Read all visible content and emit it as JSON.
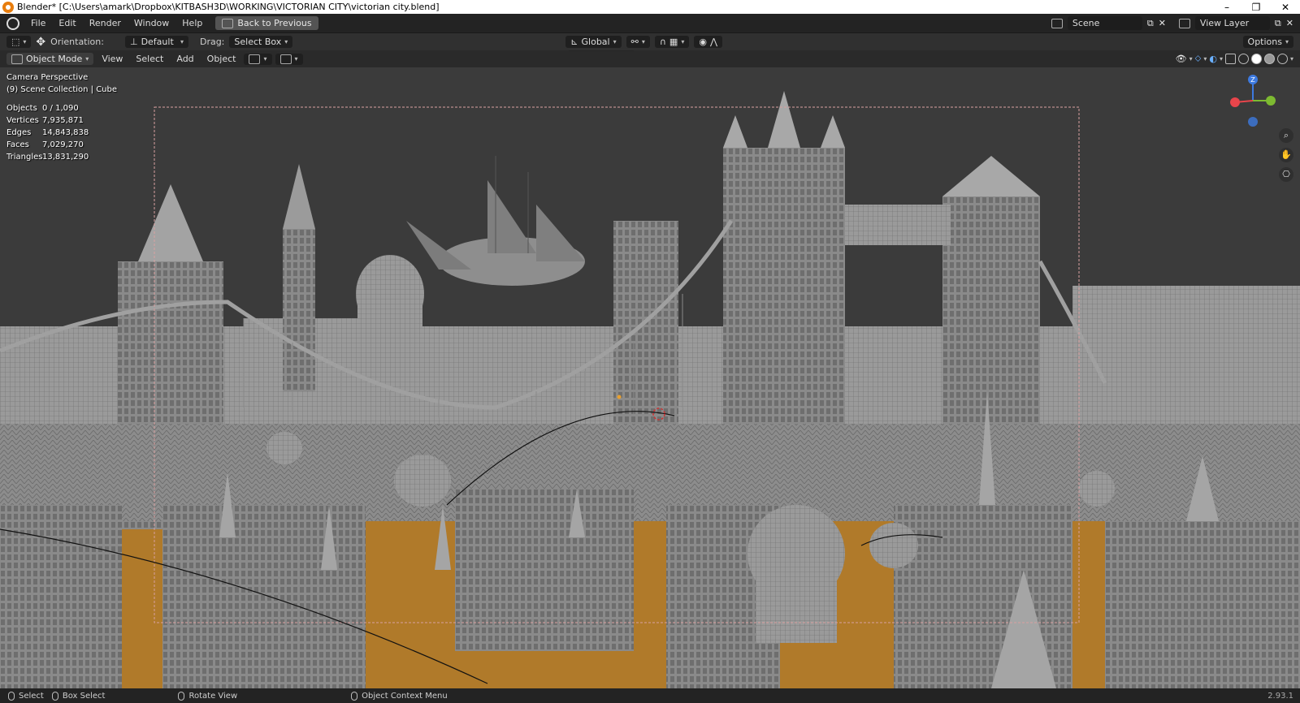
{
  "window_title": "Blender* [C:\\Users\\amark\\Dropbox\\KITBASH3D\\WORKING\\VICTORIAN CITY\\victorian city.blend]",
  "window_controls": [
    "–",
    "❐",
    "✕"
  ],
  "menu": [
    "File",
    "Edit",
    "Render",
    "Window",
    "Help"
  ],
  "back_button": "Back to Previous",
  "scene": "Scene",
  "view_layer": "View Layer",
  "toolbar": {
    "orientation_label": "Orientation:",
    "orientation_value": "Default",
    "drag_label": "Drag:",
    "drag_value": "Select Box",
    "transform_value": "Global",
    "options": "Options"
  },
  "header": {
    "mode": "Object Mode",
    "items": [
      "View",
      "Select",
      "Add",
      "Object"
    ]
  },
  "viewport": {
    "camera": "Camera Perspective",
    "collection": "(9) Scene Collection | Cube",
    "stats": [
      {
        "k": "Objects",
        "v": "0 / 1,090"
      },
      {
        "k": "Vertices",
        "v": "7,935,871"
      },
      {
        "k": "Edges",
        "v": "14,843,838"
      },
      {
        "k": "Faces",
        "v": "7,029,270"
      },
      {
        "k": "Triangles",
        "v": "13,831,290"
      }
    ],
    "gizmo_axis": "Z"
  },
  "status": {
    "select": "Select",
    "box_select": "Box Select",
    "rotate": "Rotate View",
    "context": "Object Context Menu",
    "version": "2.93.1"
  },
  "colors": {
    "accent": "#e87d0d",
    "ground": "#b07a2a",
    "x_axis": "#e8454b",
    "y_axis": "#7dba31",
    "z_axis": "#3d7ae0"
  }
}
